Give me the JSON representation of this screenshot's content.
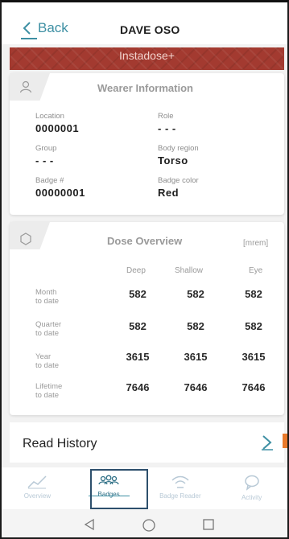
{
  "header": {
    "back_label": "Back",
    "title": "DAVE OSO"
  },
  "banner": {
    "text": "Instadose+"
  },
  "wearer": {
    "title": "Wearer Information",
    "icon": "person-icon",
    "fields": [
      {
        "label": "Location",
        "value": "0000001"
      },
      {
        "label": "Role",
        "value": "- - -"
      },
      {
        "label": "Group",
        "value": "- - -"
      },
      {
        "label": "Body region",
        "value": "Torso"
      },
      {
        "label": "Badge #",
        "value": "00000001"
      },
      {
        "label": "Badge color",
        "value": "Red"
      }
    ]
  },
  "dose": {
    "title": "Dose Overview",
    "unit": "[mrem]",
    "icon": "hexagon-icon",
    "columns": [
      "Deep",
      "Shallow",
      "Eye"
    ],
    "rows": [
      {
        "label": [
          "Month",
          "to date"
        ],
        "values": [
          "582",
          "582",
          "582"
        ]
      },
      {
        "label": [
          "Quarter",
          "to date"
        ],
        "values": [
          "582",
          "582",
          "582"
        ]
      },
      {
        "label": [
          "Year",
          "to date"
        ],
        "values": [
          "3615",
          "3615",
          "3615"
        ]
      },
      {
        "label": [
          "Lifetime",
          "to date"
        ],
        "values": [
          "7646",
          "7646",
          "7646"
        ]
      }
    ]
  },
  "read_history": {
    "label": "Read History"
  },
  "tabs": [
    {
      "label": "Overview",
      "icon": "trend-line-icon",
      "active": false
    },
    {
      "label": "Badges",
      "icon": "people-icon",
      "active": true
    },
    {
      "label": "Badge Reader",
      "icon": "wifi-icon",
      "active": false
    },
    {
      "label": "Activity",
      "icon": "chat-bubble-icon",
      "active": false
    }
  ],
  "colors": {
    "accent": "#3d8fa3",
    "banner": "#a33a30",
    "orange_tab": "#e97a2c",
    "active_border": "#2d4f6c"
  }
}
